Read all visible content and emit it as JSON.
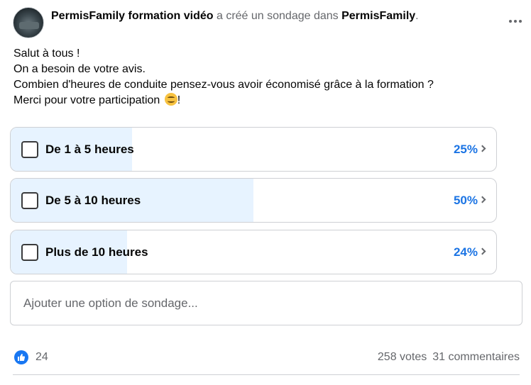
{
  "post": {
    "author": "PermisFamily formation vidéo",
    "action": "a créé un sondage dans",
    "group": "PermisFamily",
    "punct": ".",
    "lines": [
      "Salut à tous !",
      "On a besoin de votre avis.",
      "Combien d'heures de conduite pensez-vous avoir économisé grâce à la formation ?",
      "Merci pour votre participation "
    ],
    "line_end": "!"
  },
  "poll": {
    "options": [
      {
        "label": "De 1 à 5 heures",
        "percent": "25%",
        "fill": 0.25
      },
      {
        "label": "De 5 à 10 heures",
        "percent": "50%",
        "fill": 0.5
      },
      {
        "label": "Plus de 10 heures",
        "percent": "24%",
        "fill": 0.24
      }
    ],
    "add_placeholder": "Ajouter une option de sondage..."
  },
  "footer": {
    "likes": "24",
    "votes": "258 votes",
    "comments": "31 commentaires"
  },
  "colors": {
    "accent": "#1b74e4",
    "fill": "#e7f3ff",
    "like": "#1877f2"
  },
  "icons": [
    "more-icon",
    "checkbox-icon",
    "chevron-right-icon",
    "like-icon",
    "smiley-emoji-icon"
  ]
}
